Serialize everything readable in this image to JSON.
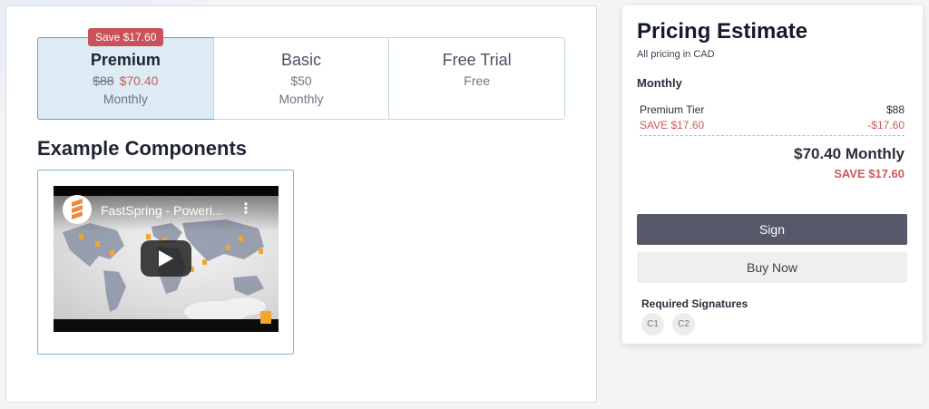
{
  "tiers": [
    {
      "name": "Premium",
      "old_price": "$88",
      "new_price": "$70.40",
      "period": "Monthly",
      "badge": "Save $17.60",
      "selected": true
    },
    {
      "name": "Basic",
      "price": "$50",
      "period": "Monthly"
    },
    {
      "name": "Free Trial",
      "price": "Free"
    }
  ],
  "main": {
    "section_heading": "Example Components",
    "video": {
      "title": "FastSpring - Poweri...",
      "menu_icon": "kebab-icon",
      "play_icon": "play-icon"
    }
  },
  "estimate": {
    "title": "Pricing Estimate",
    "subtitle": "All pricing in CAD",
    "period": "Monthly",
    "line_item": {
      "label": "Premium Tier",
      "amount": "$88"
    },
    "discount": {
      "label": "SAVE $17.60",
      "amount": "-$17.60"
    },
    "total": "$70.40 Monthly",
    "total_savings": "SAVE $17.60",
    "sign_button": "Sign",
    "buy_button": "Buy Now",
    "required_signatures_label": "Required Signatures",
    "signatures": [
      "C1",
      "C2"
    ]
  },
  "colors": {
    "accent_selected": "#dcebf4",
    "discount_red": "#cc5a5a",
    "badge_red": "#c9525a",
    "sign_button": "#545868"
  }
}
